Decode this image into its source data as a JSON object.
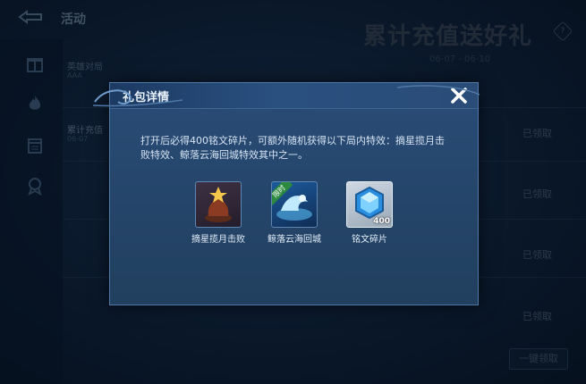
{
  "header": {
    "title": "活动",
    "back_icon": "back-arrow-icon"
  },
  "sidebar": {
    "icons": [
      "gift-icon",
      "flame-icon",
      "calendar-icon",
      "badge-icon"
    ],
    "tabs": [
      {
        "label": "英雄对局",
        "sub": "AAA"
      },
      {
        "label": "累计充值",
        "sub": "06-07"
      }
    ]
  },
  "promo": {
    "title": "累计充值送好礼",
    "help": "?",
    "date": "06-07 - 06-10"
  },
  "rows": {
    "claimed_labels": [
      "已领取",
      "已领取",
      "已领取",
      "已领取"
    ]
  },
  "footer": {
    "claim_all": "一键领取"
  },
  "modal": {
    "title": "礼包详情",
    "description": "打开后必得400铭文碎片，可额外随机获得以下局内特效：摘星揽月击败特效、鲸落云海回城特效其中之一。",
    "items": [
      {
        "name": "摘星揽月击败",
        "icon": "star-trophy-icon"
      },
      {
        "name": "鲸落云海回城",
        "icon": "whale-recall-icon",
        "badge": "限时"
      },
      {
        "name": "铭文碎片",
        "icon": "inscription-shard-icon",
        "count": "400"
      }
    ]
  },
  "colors": {
    "modal_bg": "#2a4c77",
    "accent": "#4f78a6",
    "close": "#ffffff"
  }
}
